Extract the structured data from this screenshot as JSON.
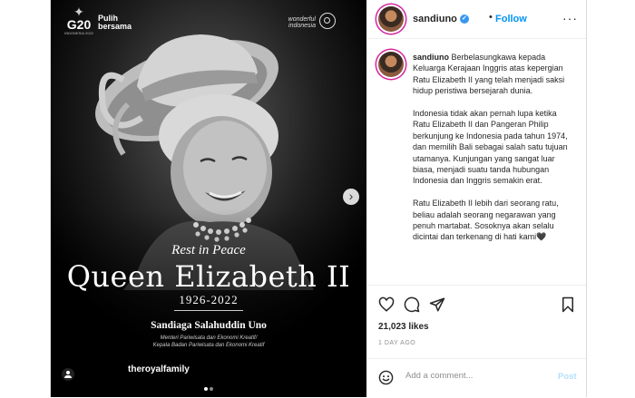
{
  "image": {
    "logo_g20": "G20",
    "logo_g20_sub": "INDONESIA 2022",
    "logo_pulih_1": "Pulih",
    "logo_pulih_2": "bersama",
    "logo_wonderful_1": "wonderful",
    "logo_wonderful_2": "indonesia",
    "rest": "Rest in Peace",
    "name": "Queen Elizabeth II",
    "years": "1926-2022",
    "signatory": "Sandiaga Salahuddin Uno",
    "signatory_title_1": "Menteri Pariwisata dan Ekonomi Kreatif/",
    "signatory_title_2": "Kepala Badan Pariwisata dan Ekonomi Kreatif",
    "source_handle": "theroyalfamily",
    "carousel_dots": 2,
    "active_dot": 1
  },
  "header": {
    "username": "sandiuno",
    "verified_mark": "✓",
    "separator": "•",
    "follow_label": "Follow",
    "more_label": "···"
  },
  "caption": {
    "username": "sandiuno",
    "p1": "Berbelasungkawa kepada Keluarga Kerajaan Inggris atas kepergian Ratu Elizabeth II yang telah menjadi saksi hidup peristiwa bersejarah dunia.",
    "p2": "Indonesia tidak akan pernah lupa ketika Ratu Elizabeth II dan Pangeran Philip berkunjung ke Indonesia pada tahun 1974, dan memilih Bali sebagai salah satu tujuan utamanya. Kunjungan yang sangat luar biasa, menjadi suatu tanda hubungan Indonesia dan Inggris semakin erat.",
    "p3": "Ratu Elizabeth II lebih dari seorang ratu, beliau adalah seorang negarawan yang penuh martabat. Sosoknya akan selalu dicintai dan terkenang di hati kami🖤"
  },
  "stats": {
    "likes": "21,023 likes",
    "time": "1 DAY AGO"
  },
  "comment": {
    "placeholder": "Add a comment...",
    "post_label": "Post"
  },
  "colors": {
    "follow": "#0095f6",
    "post_disabled": "#b2dffc",
    "verified": "#3897f0",
    "story_ring": "#d6249f"
  },
  "icons": [
    "heart-icon",
    "comment-icon",
    "share-icon",
    "bookmark-icon",
    "emoji-icon",
    "user-tag-icon",
    "chevron-right-icon"
  ]
}
